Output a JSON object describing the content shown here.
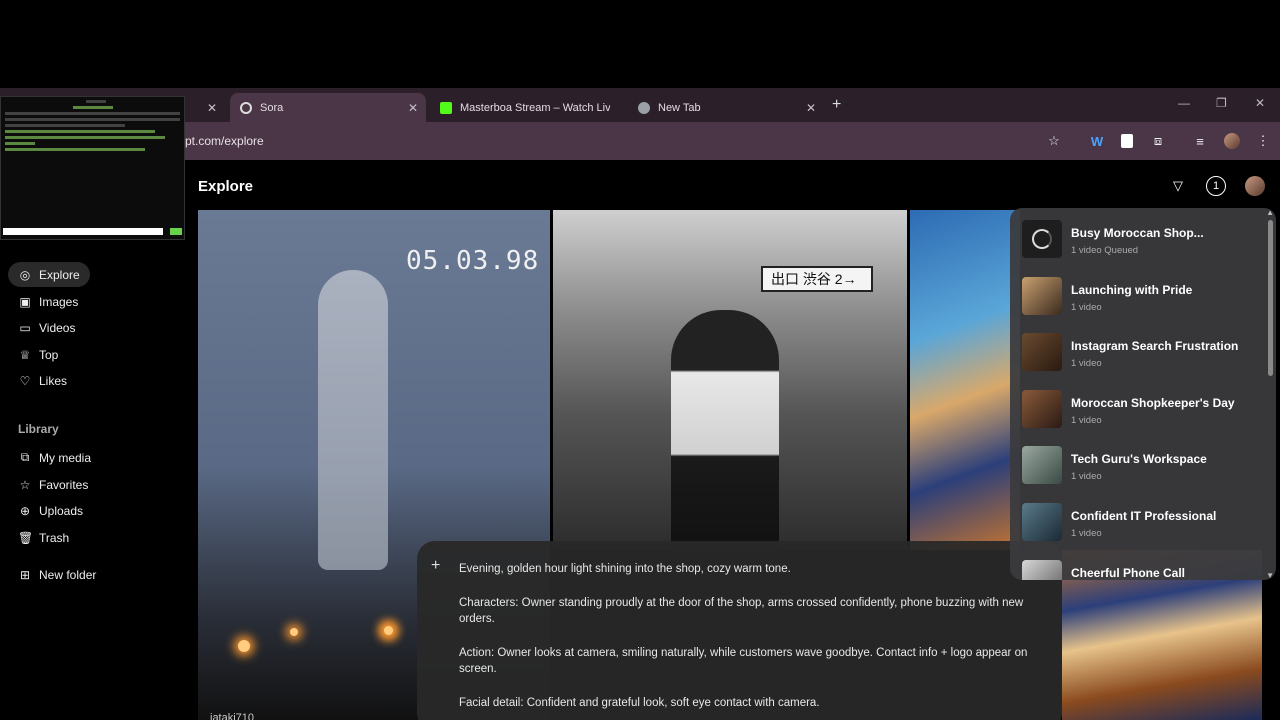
{
  "browser": {
    "tabs": [
      {
        "label": "",
        "close": "✕"
      },
      {
        "label": "Sora",
        "close": "✕"
      },
      {
        "label": "Masterboa Stream – Watch Live",
        "close": ""
      },
      {
        "label": "New Tab",
        "close": "✕"
      }
    ],
    "new_tab": "+",
    "url": "pt.com/explore",
    "window_controls": {
      "minimize": "—",
      "maximize": "❐",
      "close": "✕"
    }
  },
  "header": {
    "title": "Explore",
    "notification_count": "1"
  },
  "sidebar": {
    "items": [
      {
        "label": "Explore",
        "icon": "compass-icon",
        "glyph": "◎"
      },
      {
        "label": "Images",
        "icon": "image-icon",
        "glyph": "▣"
      },
      {
        "label": "Videos",
        "icon": "video-icon",
        "glyph": "▭"
      },
      {
        "label": "Top",
        "icon": "trophy-icon",
        "glyph": "♕"
      },
      {
        "label": "Likes",
        "icon": "heart-icon",
        "glyph": "♡"
      }
    ],
    "library_heading": "Library",
    "library_items": [
      {
        "label": "My media",
        "icon": "media-icon",
        "glyph": "⧉"
      },
      {
        "label": "Favorites",
        "icon": "star-icon",
        "glyph": "☆"
      },
      {
        "label": "Uploads",
        "icon": "upload-icon",
        "glyph": "⊕"
      },
      {
        "label": "Trash",
        "icon": "trash-icon",
        "glyph": "🗑"
      },
      {
        "label": "New folder",
        "icon": "folder-plus-icon",
        "glyph": "⊞"
      }
    ]
  },
  "media": {
    "date_overlay": "05.03.98",
    "station_sign": "出口 渋谷  2→",
    "bottom_user": "jataki710"
  },
  "prompt": {
    "plus": "+",
    "lines": [
      "Evening, golden hour light shining into the shop, cozy warm tone.",
      "Characters: Owner standing proudly at the door of the shop, arms crossed confidently, phone buzzing with new orders.",
      "Action: Owner looks at camera, smiling naturally, while customers wave goodbye. Contact info + logo appear on screen.",
      "Facial detail: Confident and grateful look, soft eye contact with camera."
    ]
  },
  "queue": {
    "items": [
      {
        "title": "Busy Moroccan Shop...",
        "sub": "1 video   Queued",
        "status": "queued"
      },
      {
        "title": "Launching with Pride",
        "sub": "1 video",
        "status": "done"
      },
      {
        "title": "Instagram Search Frustration",
        "sub": "1 video",
        "status": "done"
      },
      {
        "title": "Moroccan Shopkeeper's Day",
        "sub": "1 video",
        "status": "done"
      },
      {
        "title": "Tech Guru's Workspace",
        "sub": "1 video",
        "status": "done"
      },
      {
        "title": "Confident IT Professional",
        "sub": "1 video",
        "status": "done"
      },
      {
        "title": "Cheerful Phone Call",
        "sub": "",
        "status": "done"
      }
    ]
  },
  "colors": {
    "tabbar": "#2b1f2a",
    "addressbar": "#4a3646",
    "page_bg": "#000000",
    "panel_bg": "#3a3a3e"
  }
}
